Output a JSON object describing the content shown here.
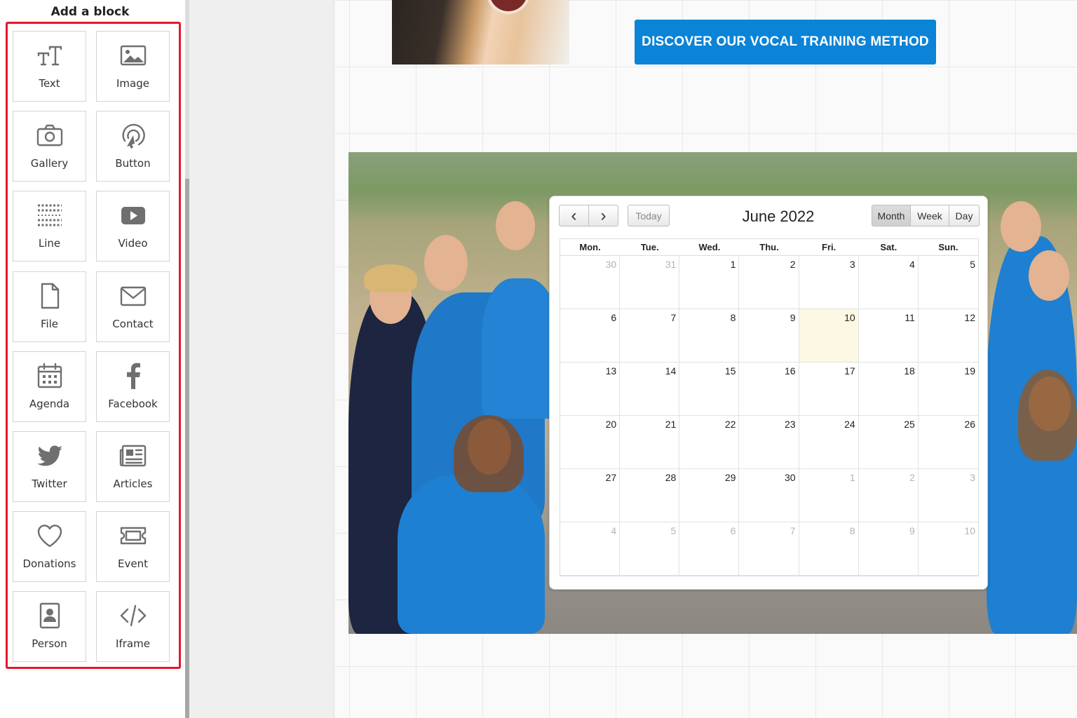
{
  "sidebar": {
    "title": "Add a block",
    "blocks": [
      {
        "label": "Text",
        "icon": "text-icon"
      },
      {
        "label": "Image",
        "icon": "image-icon"
      },
      {
        "label": "Gallery",
        "icon": "camera-icon"
      },
      {
        "label": "Button",
        "icon": "cursor-target-icon"
      },
      {
        "label": "Line",
        "icon": "dotted-line-icon"
      },
      {
        "label": "Video",
        "icon": "play-icon"
      },
      {
        "label": "File",
        "icon": "file-icon"
      },
      {
        "label": "Contact",
        "icon": "envelope-icon"
      },
      {
        "label": "Agenda",
        "icon": "calendar-icon"
      },
      {
        "label": "Facebook",
        "icon": "facebook-icon"
      },
      {
        "label": "Twitter",
        "icon": "twitter-bird-icon"
      },
      {
        "label": "Articles",
        "icon": "newspaper-icon"
      },
      {
        "label": "Donations",
        "icon": "heart-icon"
      },
      {
        "label": "Event",
        "icon": "ticket-icon"
      },
      {
        "label": "Person",
        "icon": "person-badge-icon"
      },
      {
        "label": "Iframe",
        "icon": "code-icon"
      }
    ],
    "highlight_color": "#e3182d"
  },
  "canvas": {
    "cta_label": "DISCOVER OUR VOCAL TRAINING METHOD",
    "cta_color": "#0b83d6"
  },
  "calendar": {
    "title": "June 2022",
    "today_label": "Today",
    "prev_icon": "‹",
    "next_icon": "›",
    "views": [
      "Month",
      "Week",
      "Day"
    ],
    "active_view": "Month",
    "weekdays": [
      "Mon.",
      "Tue.",
      "Wed.",
      "Thu.",
      "Fri.",
      "Sat.",
      "Sun."
    ],
    "weeks": [
      [
        "30",
        "31",
        "1",
        "2",
        "3",
        "4",
        "5"
      ],
      [
        "6",
        "7",
        "8",
        "9",
        "10",
        "11",
        "12"
      ],
      [
        "13",
        "14",
        "15",
        "16",
        "17",
        "18",
        "19"
      ],
      [
        "20",
        "21",
        "22",
        "23",
        "24",
        "25",
        "26"
      ],
      [
        "27",
        "28",
        "29",
        "30",
        "1",
        "2",
        "3"
      ],
      [
        "4",
        "5",
        "6",
        "7",
        "8",
        "9",
        "10"
      ]
    ],
    "today_date": "10",
    "today_highlight": "#fcf8e3"
  }
}
